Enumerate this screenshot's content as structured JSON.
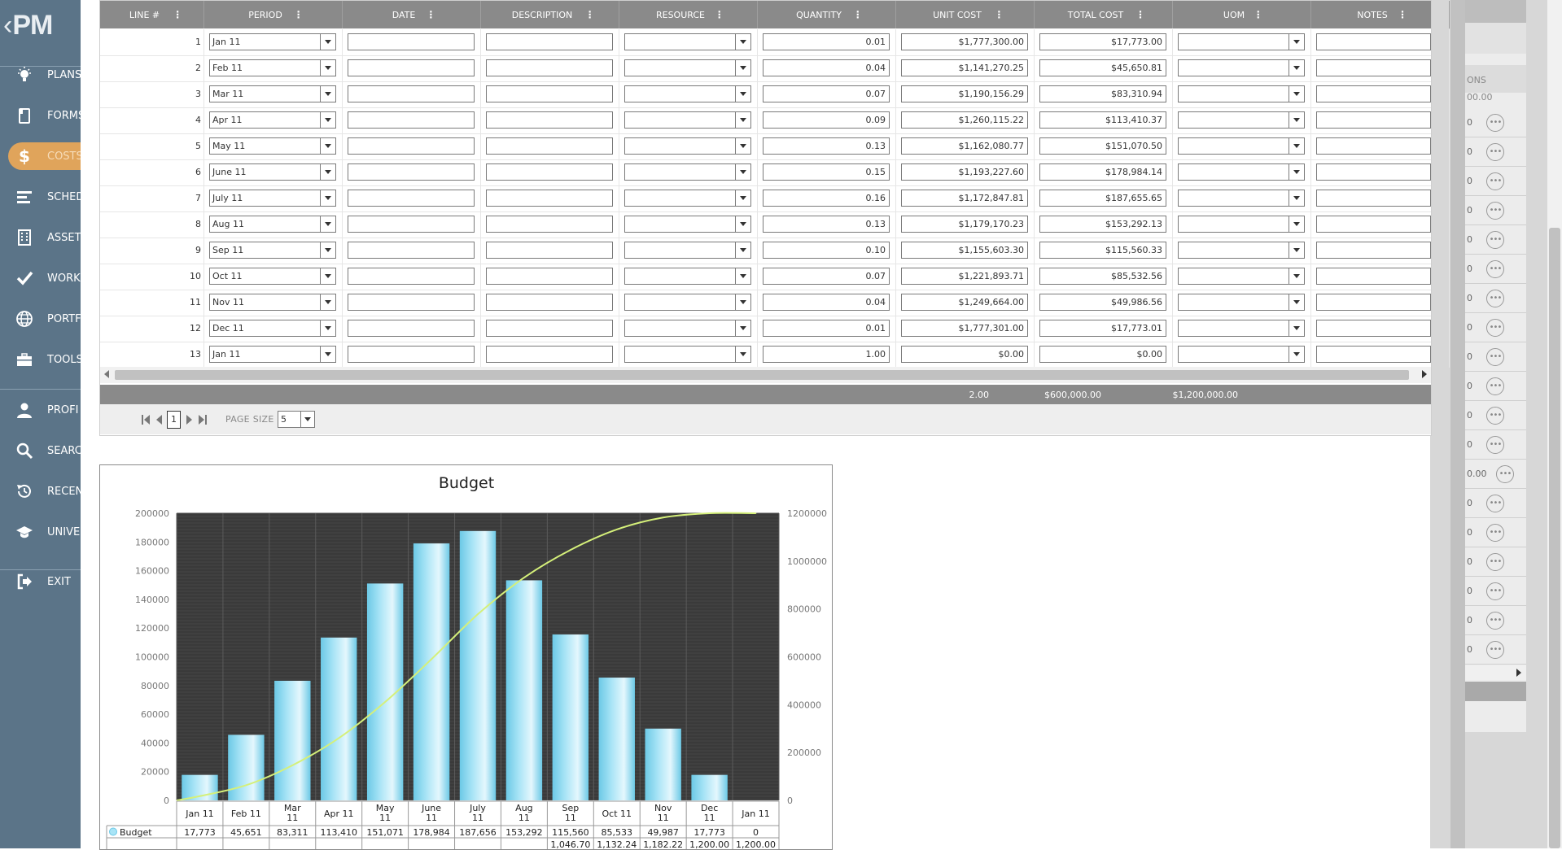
{
  "app": {
    "logo_text": "PM"
  },
  "sidebar": {
    "items": [
      {
        "label": "PLANS",
        "icon": "lightbulb-icon"
      },
      {
        "label": "FORMS",
        "icon": "forms-icon"
      },
      {
        "label": "COSTS",
        "icon": "dollar-icon"
      },
      {
        "label": "SCHED",
        "icon": "schedule-icon"
      },
      {
        "label": "ASSET",
        "icon": "asset-icon"
      },
      {
        "label": "WORK",
        "icon": "check-icon"
      },
      {
        "label": "PORTF",
        "icon": "globe-icon"
      },
      {
        "label": "TOOLS",
        "icon": "toolbox-icon"
      },
      {
        "label": "PROFI",
        "icon": "user-icon"
      },
      {
        "label": "SEARC",
        "icon": "search-icon"
      },
      {
        "label": "RECEN",
        "icon": "history-icon"
      },
      {
        "label": "UNIVE",
        "icon": "graduation-icon"
      },
      {
        "label": "EXIT",
        "icon": "exit-icon"
      }
    ]
  },
  "grid": {
    "columns": [
      "LINE #",
      "PERIOD",
      "DATE",
      "DESCRIPTION",
      "RESOURCE",
      "QUANTITY",
      "UNIT COST",
      "TOTAL COST",
      "UOM",
      "NOTES"
    ],
    "rows": [
      {
        "line": "1",
        "period": "Jan 11",
        "quantity": "0.01",
        "unit_cost": "$1,777,300.00",
        "total_cost": "$17,773.00"
      },
      {
        "line": "2",
        "period": "Feb 11",
        "quantity": "0.04",
        "unit_cost": "$1,141,270.25",
        "total_cost": "$45,650.81"
      },
      {
        "line": "3",
        "period": "Mar 11",
        "quantity": "0.07",
        "unit_cost": "$1,190,156.29",
        "total_cost": "$83,310.94"
      },
      {
        "line": "4",
        "period": "Apr 11",
        "quantity": "0.09",
        "unit_cost": "$1,260,115.22",
        "total_cost": "$113,410.37"
      },
      {
        "line": "5",
        "period": "May 11",
        "quantity": "0.13",
        "unit_cost": "$1,162,080.77",
        "total_cost": "$151,070.50"
      },
      {
        "line": "6",
        "period": "June 11",
        "quantity": "0.15",
        "unit_cost": "$1,193,227.60",
        "total_cost": "$178,984.14"
      },
      {
        "line": "7",
        "period": "July 11",
        "quantity": "0.16",
        "unit_cost": "$1,172,847.81",
        "total_cost": "$187,655.65"
      },
      {
        "line": "8",
        "period": "Aug 11",
        "quantity": "0.13",
        "unit_cost": "$1,179,170.23",
        "total_cost": "$153,292.13"
      },
      {
        "line": "9",
        "period": "Sep 11",
        "quantity": "0.10",
        "unit_cost": "$1,155,603.30",
        "total_cost": "$115,560.33"
      },
      {
        "line": "10",
        "period": "Oct 11",
        "quantity": "0.07",
        "unit_cost": "$1,221,893.71",
        "total_cost": "$85,532.56"
      },
      {
        "line": "11",
        "period": "Nov 11",
        "quantity": "0.04",
        "unit_cost": "$1,249,664.00",
        "total_cost": "$49,986.56"
      },
      {
        "line": "12",
        "period": "Dec 11",
        "quantity": "0.01",
        "unit_cost": "$1,777,301.00",
        "total_cost": "$17,773.01"
      },
      {
        "line": "13",
        "period": "Jan 11",
        "quantity": "1.00",
        "unit_cost": "$0.00",
        "total_cost": "$0.00"
      }
    ],
    "totals": {
      "quantity": "2.00",
      "unit_cost": "$600,000.00",
      "total_cost": "$1,200,000.00"
    },
    "pager": {
      "current_page": "1",
      "page_size_label": "PAGE SIZE",
      "page_size_value": "5"
    }
  },
  "right_panel": {
    "header_fragment": "ONS",
    "top_value": "00.00",
    "row_prefix": "0",
    "odd_value": "0.00"
  },
  "chart_data": {
    "type": "bar",
    "title": "Budget",
    "categories": [
      "Jan 11",
      "Feb 11",
      "Mar 11",
      "Apr 11",
      "May 11",
      "June 11",
      "July 11",
      "Aug 11",
      "Sep 11",
      "Oct 11",
      "Nov 11",
      "Dec 11",
      "Jan 11"
    ],
    "categories_wrapped": [
      [
        "Jan 11"
      ],
      [
        "Feb 11"
      ],
      [
        "Mar",
        "11"
      ],
      [
        "Apr 11"
      ],
      [
        "May",
        "11"
      ],
      [
        "June",
        "11"
      ],
      [
        "July",
        "11"
      ],
      [
        "Aug",
        "11"
      ],
      [
        "Sep",
        "11"
      ],
      [
        "Oct 11"
      ],
      [
        "Nov",
        "11"
      ],
      [
        "Dec",
        "11"
      ],
      [
        "Jan 11"
      ]
    ],
    "series": [
      {
        "name": "Budget",
        "type": "bar",
        "axis": "left",
        "values": [
          17773,
          45651,
          83311,
          113410,
          151071,
          178984,
          187656,
          153292,
          115560,
          85533,
          49987,
          17773,
          0
        ]
      },
      {
        "type": "line",
        "axis": "right",
        "values": [
          17773,
          63424,
          146735,
          260145,
          411216,
          590200,
          777856,
          931148,
          1046708,
          1132241,
          1182228,
          1200001,
          1200001
        ]
      }
    ],
    "table_rows": [
      {
        "label": "Budget",
        "values": [
          "17,773",
          "45,651",
          "83,311",
          "113,410",
          "151,071",
          "178,984",
          "187,656",
          "153,292",
          "115,560",
          "85,533",
          "49,987",
          "17,773",
          "0"
        ]
      },
      {
        "label": "",
        "values": [
          "",
          "",
          "",
          "",
          "",
          "",
          "",
          "",
          "1,046.70",
          "1,132.24",
          "1,182.22",
          "1,200.00",
          "1,200.00"
        ]
      }
    ],
    "ylim": [
      0,
      200000
    ],
    "yticks": [
      0,
      20000,
      40000,
      60000,
      80000,
      100000,
      120000,
      140000,
      160000,
      180000,
      200000
    ],
    "y2lim": [
      0,
      1200000
    ],
    "y2ticks": [
      0,
      200000,
      400000,
      600000,
      800000,
      1000000,
      1200000
    ],
    "grid": true,
    "colors": {
      "bar": "#a8e4f6",
      "bar_dark": "#6cc9e6",
      "line": "#d5f07a",
      "plot_bg": "#3a3a3a"
    }
  }
}
